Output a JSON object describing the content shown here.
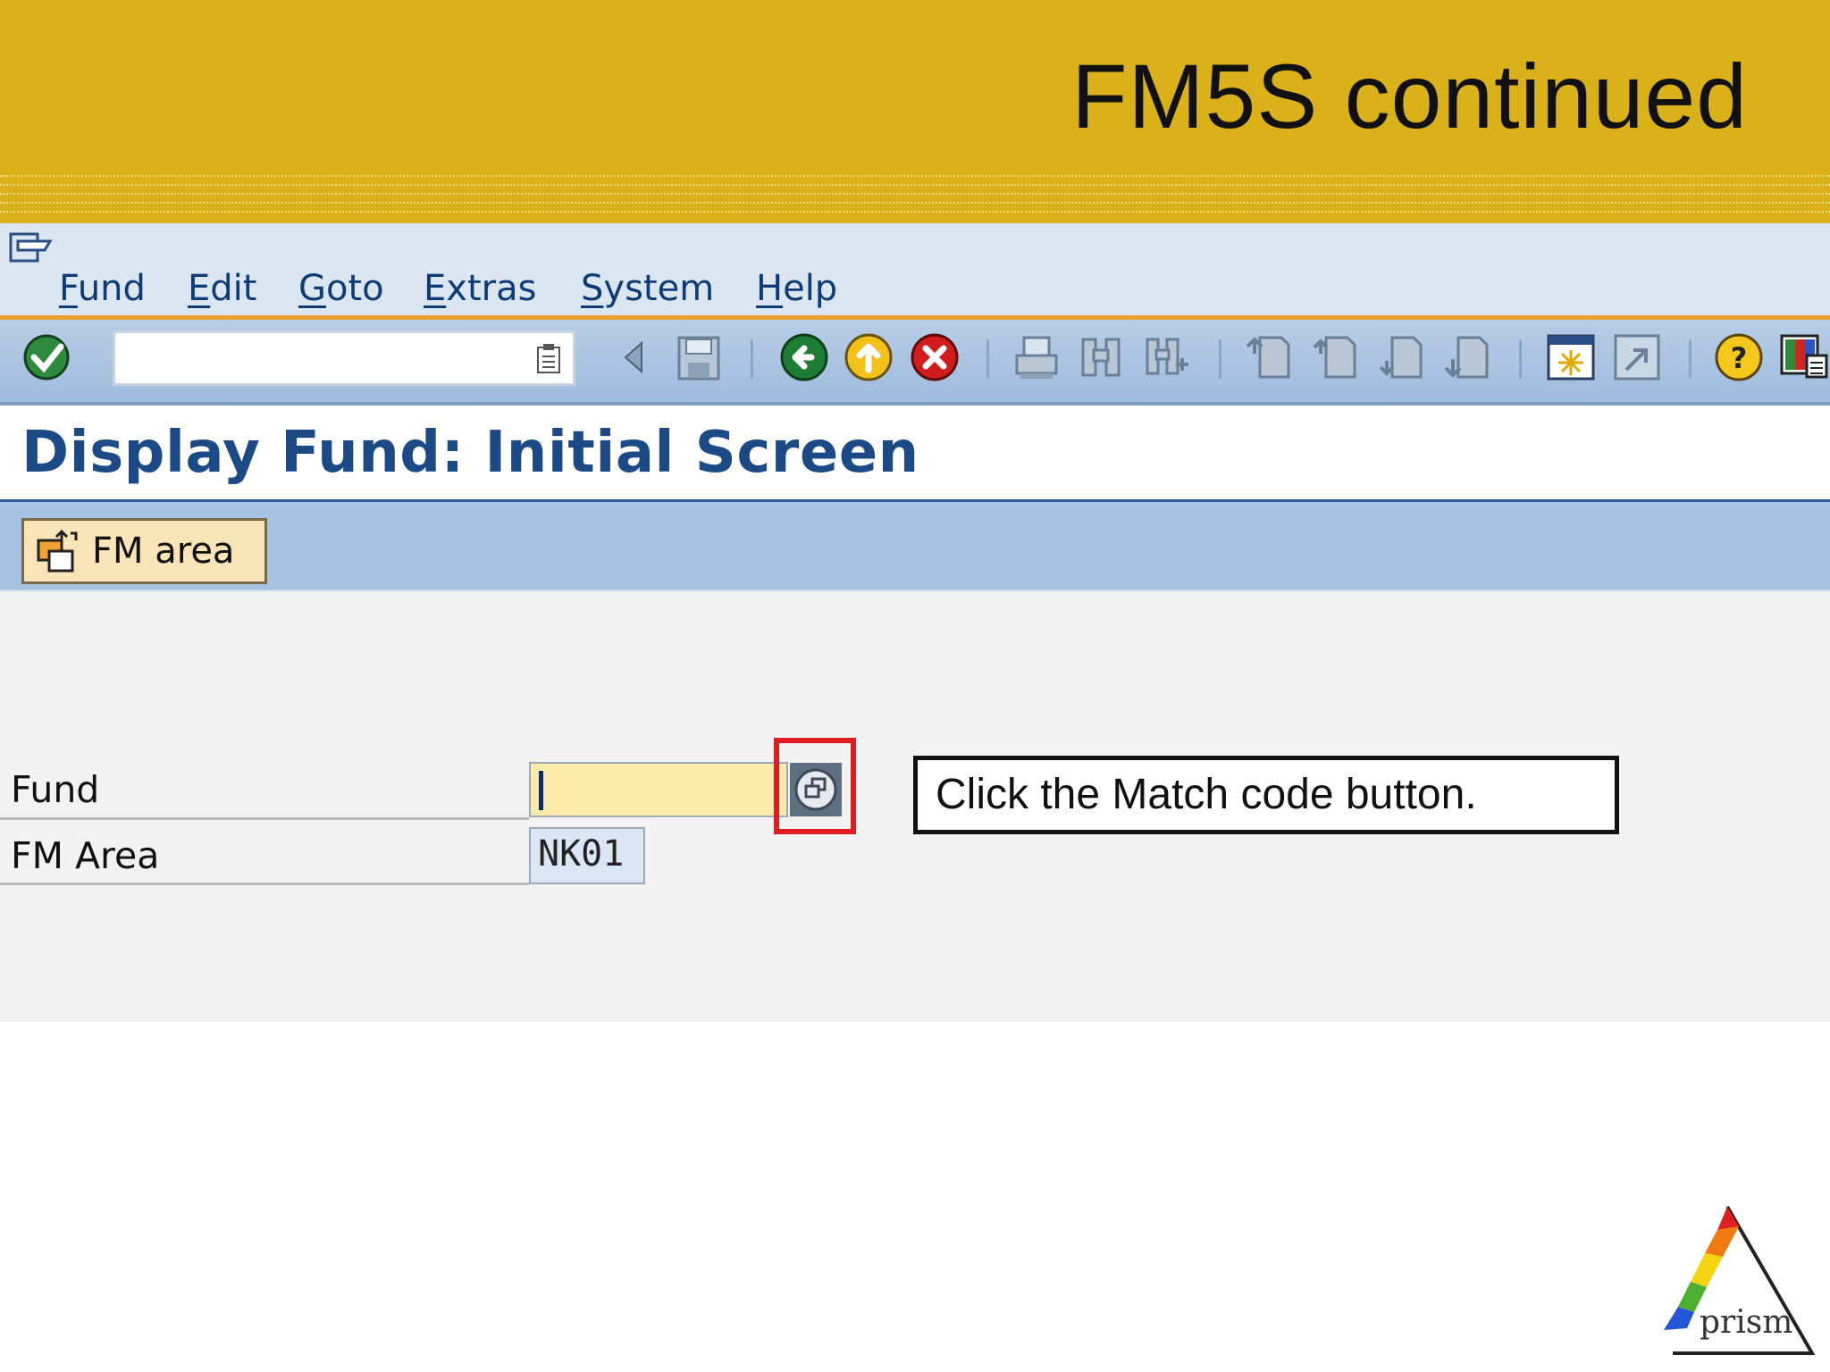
{
  "slide": {
    "title": "FM5S continued",
    "logo_text": "prism"
  },
  "menubar": {
    "items": [
      {
        "label_first": "F",
        "label_rest": "und"
      },
      {
        "label_first": "E",
        "label_rest": "dit"
      },
      {
        "label_first": "G",
        "label_rest": "oto"
      },
      {
        "label_first": "E",
        "label_rest": "xtras"
      },
      {
        "label_first": "S",
        "label_rest": "ystem"
      },
      {
        "label_first": "H",
        "label_rest": "elp"
      }
    ]
  },
  "toolbar": {
    "command_field_value": "",
    "icons": [
      "enter-check-icon",
      "command-history-icon",
      "back-triangle-icon",
      "save-icon",
      "back-icon",
      "exit-icon",
      "cancel-icon",
      "print-icon",
      "find-icon",
      "find-next-icon",
      "first-page-icon",
      "previous-page-icon",
      "next-page-icon",
      "last-page-icon",
      "create-session-icon",
      "shortcut-icon",
      "help-icon",
      "layout-menu-icon"
    ]
  },
  "screen": {
    "title": "Display Fund: Initial Screen",
    "app_button_label": "FM area"
  },
  "form": {
    "fund_label": "Fund",
    "fund_value": "",
    "fm_area_label": "FM Area",
    "fm_area_value": "NK01"
  },
  "callout": {
    "text": "Click the Match code button."
  },
  "colors": {
    "banner": "#dbb11a",
    "menubar": "#dce6f0",
    "accent_orange": "#f0a030",
    "toolbar": "#a7c2e3",
    "title_blue": "#1c4a86",
    "highlight_red": "#e11b22",
    "fund_input": "#fbeaa8"
  }
}
